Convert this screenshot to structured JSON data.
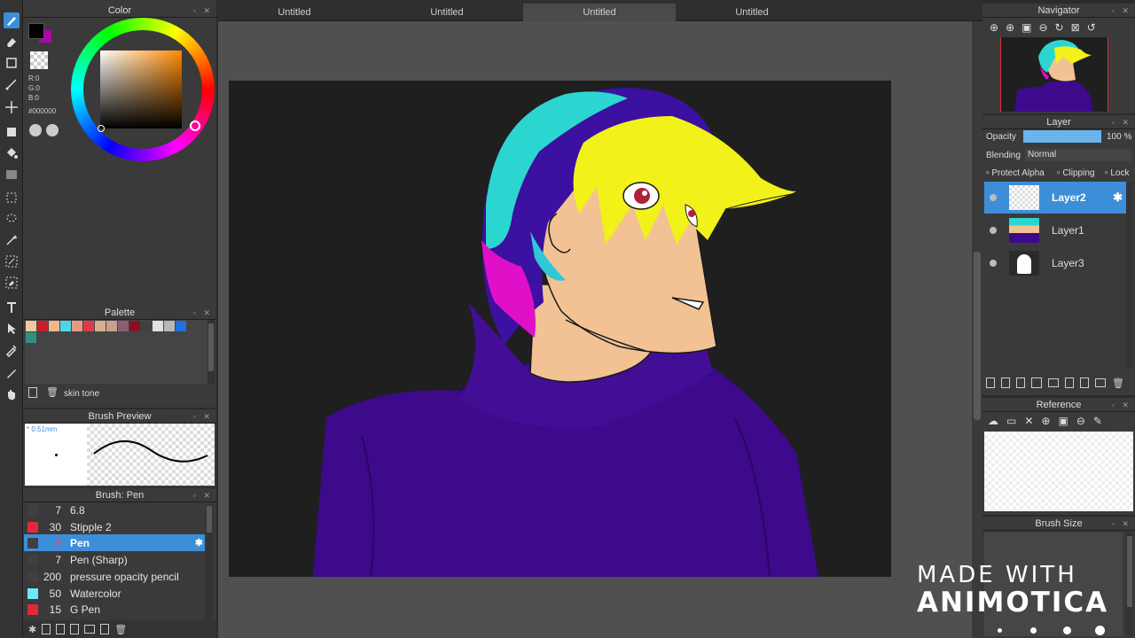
{
  "tabs": [
    {
      "label": "Untitled"
    },
    {
      "label": "Untitled"
    },
    {
      "label": "Untitled"
    },
    {
      "label": "Untitled"
    }
  ],
  "color_panel": {
    "title": "Color",
    "r": "R:0",
    "g": "G:0",
    "b": "B:0",
    "hex": "#000000",
    "main_color": "#000000",
    "sub_color": "#b000b0"
  },
  "palette_panel": {
    "title": "Palette",
    "swatches": [
      "#f2c8a0",
      "#c81e2a",
      "#f2b88c",
      "#4fd4e8",
      "#e89a80",
      "#e03a4a",
      "#d8b090",
      "#c8a090",
      "#8a6070",
      "#8a1020",
      "#404040",
      "#e0e0e0",
      "#b8b8b8",
      "#2070e0",
      "#309080"
    ],
    "name": "skin tone"
  },
  "brush_preview": {
    "title": "Brush Preview",
    "size": "* 0.51mm"
  },
  "brush_list": {
    "title": "Brush: Pen",
    "items": [
      {
        "size": "7",
        "name": "6.8",
        "color": "#404040"
      },
      {
        "size": "30",
        "name": "Stipple 2",
        "color": "#e02a3a"
      },
      {
        "size": "7",
        "name": "Pen",
        "color": "#404040"
      },
      {
        "size": "7",
        "name": "Pen (Sharp)",
        "color": "#404040"
      },
      {
        "size": "200",
        "name": "pressure opacity pencil",
        "color": "#404040"
      },
      {
        "size": "50",
        "name": "Watercolor",
        "color": "#6ee8f8"
      },
      {
        "size": "15",
        "name": "G Pen",
        "color": "#e02a3a"
      }
    ]
  },
  "navigator": {
    "title": "Navigator"
  },
  "layer_panel": {
    "title": "Layer",
    "opacity_label": "Opacity",
    "opacity_value": "100 %",
    "opacity_fraction": 1.0,
    "blending_label": "Blending",
    "blending_value": "Normal",
    "protect_alpha": "Protect Alpha",
    "clipping": "Clipping",
    "lock": "Lock",
    "layers": [
      {
        "name": "Layer2"
      },
      {
        "name": "Layer1"
      },
      {
        "name": "Layer3"
      }
    ]
  },
  "reference_panel": {
    "title": "Reference"
  },
  "brush_size_panel": {
    "title": "Brush Size"
  },
  "watermark": {
    "line1": "MADE WITH",
    "line2": "ANIMOTICA"
  }
}
